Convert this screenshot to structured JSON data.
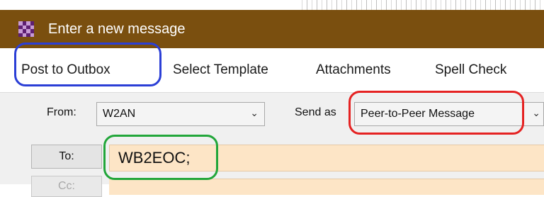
{
  "window": {
    "title": "Enter a new message",
    "titlebar_color": "#7a4f0f",
    "icon": "checkerboard-app-icon"
  },
  "menu": {
    "items": [
      {
        "label": "Post to Outbox"
      },
      {
        "label": "Select Template"
      },
      {
        "label": "Attachments"
      },
      {
        "label": "Spell Check"
      }
    ]
  },
  "form": {
    "from_label": "From:",
    "from_value": "W2AN",
    "send_as_label": "Send as",
    "send_as_value": "Peer-to-Peer Message",
    "to_button": "To:",
    "to_value": "WB2EOC;",
    "cc_button": "Cc:",
    "field_bg_color": "#fde5c6"
  },
  "annotations": {
    "blue": "#2b3fd6",
    "red": "#e52222",
    "green": "#22a63a"
  }
}
